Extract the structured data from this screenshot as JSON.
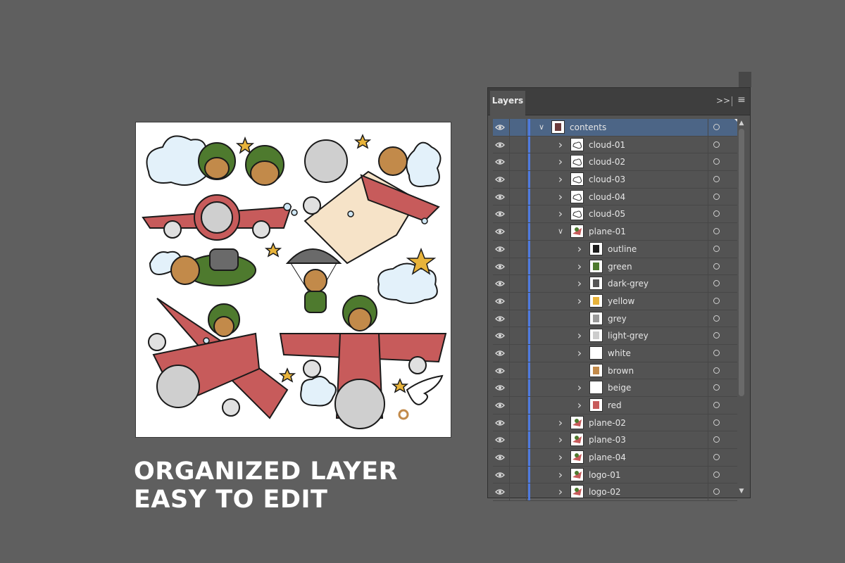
{
  "headline": {
    "line1": "ORGANIZED LAYER",
    "line2": "EASY TO EDIT"
  },
  "panel": {
    "tab_label": "Layers",
    "collapse_icon": "double-chevron-right-icon",
    "menu_icon": "hamburger-menu-icon",
    "selection_color": "#4c6586",
    "layer_color_bar": "#4f7be0"
  },
  "layers": [
    {
      "name": "contents",
      "depth": 0,
      "expanded": true,
      "has_children": true,
      "selected": true
    },
    {
      "name": "cloud-01",
      "depth": 1,
      "expanded": false,
      "has_children": true
    },
    {
      "name": "cloud-02",
      "depth": 1,
      "expanded": false,
      "has_children": true
    },
    {
      "name": "cloud-03",
      "depth": 1,
      "expanded": false,
      "has_children": true
    },
    {
      "name": "cloud-04",
      "depth": 1,
      "expanded": false,
      "has_children": true
    },
    {
      "name": "cloud-05",
      "depth": 1,
      "expanded": false,
      "has_children": true
    },
    {
      "name": "plane-01",
      "depth": 1,
      "expanded": true,
      "has_children": true
    },
    {
      "name": "outline",
      "depth": 2,
      "expanded": false,
      "has_children": true
    },
    {
      "name": "green",
      "depth": 2,
      "expanded": false,
      "has_children": true
    },
    {
      "name": "dark-grey",
      "depth": 2,
      "expanded": false,
      "has_children": true
    },
    {
      "name": "yellow",
      "depth": 2,
      "expanded": false,
      "has_children": true
    },
    {
      "name": "grey",
      "depth": 2,
      "expanded": false,
      "has_children": false
    },
    {
      "name": "light-grey",
      "depth": 2,
      "expanded": false,
      "has_children": true
    },
    {
      "name": "white",
      "depth": 2,
      "expanded": false,
      "has_children": true
    },
    {
      "name": "brown",
      "depth": 2,
      "expanded": false,
      "has_children": false
    },
    {
      "name": "beige",
      "depth": 2,
      "expanded": false,
      "has_children": true
    },
    {
      "name": "red",
      "depth": 2,
      "expanded": false,
      "has_children": true
    },
    {
      "name": "plane-02",
      "depth": 1,
      "expanded": false,
      "has_children": true
    },
    {
      "name": "plane-03",
      "depth": 1,
      "expanded": false,
      "has_children": true
    },
    {
      "name": "plane-04",
      "depth": 1,
      "expanded": false,
      "has_children": true
    },
    {
      "name": "logo-01",
      "depth": 1,
      "expanded": false,
      "has_children": true
    },
    {
      "name": "logo-02",
      "depth": 1,
      "expanded": false,
      "has_children": true
    }
  ],
  "icons": {
    "visibility": "eye-icon",
    "expand": "chevron-right-icon",
    "collapse": "chevron-down-icon",
    "target": "target-circle-icon"
  },
  "colors": {
    "background": "#5f5f5f",
    "plane_red": "#c75b5b",
    "helmet_green": "#4e7a2e",
    "star_yellow": "#e8b33a",
    "cloud_blue": "#cfe7f5"
  }
}
